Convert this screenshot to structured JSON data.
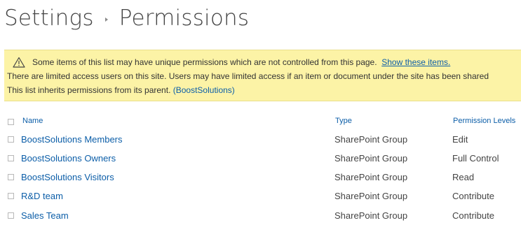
{
  "breadcrumb": {
    "root": "Settings",
    "current": "Permissions"
  },
  "notice": {
    "line1_text": "Some items of this list may have unique permissions which are not controlled from this page.",
    "line1_link": "Show these items.",
    "line2_text": "There are limited access users on this site. Users may have limited access if an item or document under the site has been shared",
    "line3_text": "This list inherits permissions from its parent.",
    "line3_link": "(BoostSolutions)",
    "icon": "warning-icon"
  },
  "table": {
    "columns": {
      "name": "Name",
      "type": "Type",
      "permission_levels": "Permission Levels"
    },
    "rows": [
      {
        "name": "BoostSolutions Members",
        "type": "SharePoint Group",
        "permission": "Edit"
      },
      {
        "name": "BoostSolutions Owners",
        "type": "SharePoint Group",
        "permission": "Full Control"
      },
      {
        "name": "BoostSolutions Visitors",
        "type": "SharePoint Group",
        "permission": "Read"
      },
      {
        "name": "R&D team",
        "type": "SharePoint Group",
        "permission": "Contribute"
      },
      {
        "name": "Sales Team",
        "type": "SharePoint Group",
        "permission": "Contribute"
      }
    ]
  },
  "colors": {
    "link": "#0c5ea8",
    "text": "#444444",
    "notice_bg": "#fcf3a6"
  }
}
